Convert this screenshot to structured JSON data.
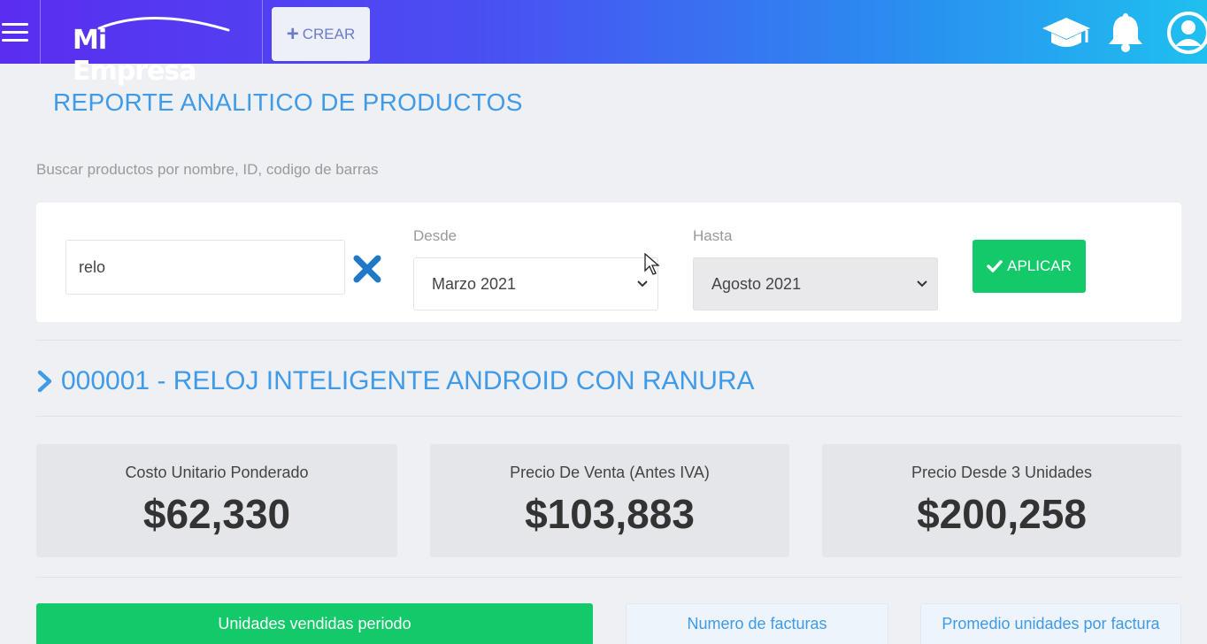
{
  "header": {
    "logo_text": "Mi Empresa",
    "create_label": "CREAR"
  },
  "page": {
    "title": "REPORTE ANALITICO DE PRODUCTOS",
    "search_hint": "Buscar productos por nombre, ID, codigo de barras"
  },
  "filters": {
    "search_value": "relo",
    "desde_label": "Desde",
    "desde_value": "Marzo 2021",
    "hasta_label": "Hasta",
    "hasta_value": "Agosto 2021",
    "apply_label": "APLICAR"
  },
  "product": {
    "heading": "000001 - RELOJ INTELIGENTE ANDROID CON RANURA"
  },
  "stats": [
    {
      "label": "Costo Unitario Ponderado",
      "value": "$62,330"
    },
    {
      "label": "Precio De Venta (Antes IVA)",
      "value": "$103,883"
    },
    {
      "label": "Precio Desde 3 Unidades",
      "value": "$200,258"
    }
  ],
  "tabs": [
    {
      "label": "Unidades vendidas periodo"
    },
    {
      "label": "Numero de facturas"
    },
    {
      "label": "Promedio unidades por factura"
    }
  ],
  "colors": {
    "accent_blue": "#3f9ae8",
    "success_green": "#14c96a"
  }
}
